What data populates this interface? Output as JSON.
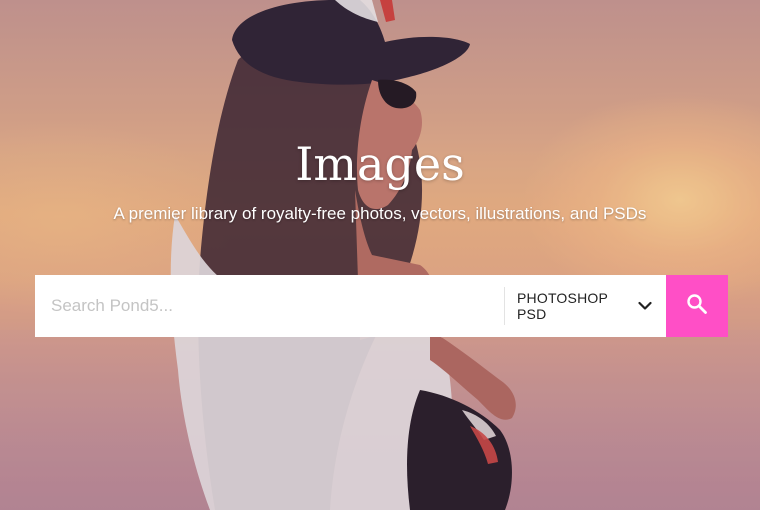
{
  "hero": {
    "title": "Images",
    "subtitle": "A premier library of royalty-free photos, vectors, illustrations, and PSDs"
  },
  "search": {
    "placeholder": "Search Pond5...",
    "value": "",
    "type_selected": "PHOTOSHOP PSD",
    "button_icon": "search-icon",
    "button_color": "#ff4fc6"
  },
  "icons": {
    "chevron": "chevron-down-icon",
    "search": "search-icon"
  }
}
